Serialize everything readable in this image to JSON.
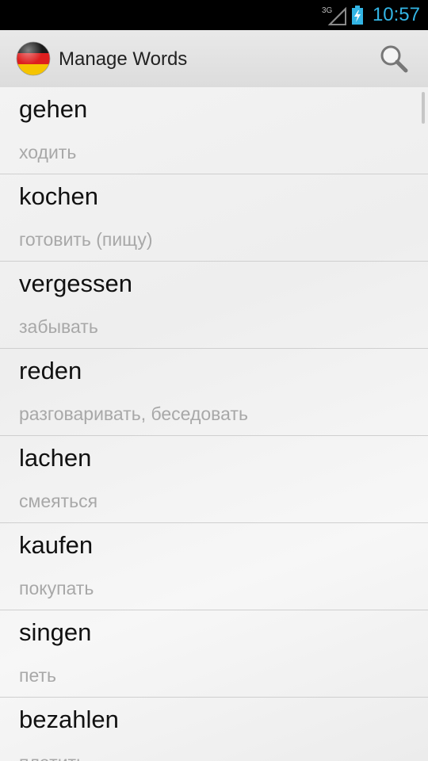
{
  "status_bar": {
    "network": "3G",
    "time": "10:57",
    "accent_color": "#33b5e5"
  },
  "action_bar": {
    "title": "Manage Words",
    "app_icon": "germany-flag-icon",
    "search_icon": "search-icon"
  },
  "words": [
    {
      "word": "gehen",
      "translation": "ходить"
    },
    {
      "word": "kochen",
      "translation": "готовить (пищу)"
    },
    {
      "word": "vergessen",
      "translation": "забывать"
    },
    {
      "word": "reden",
      "translation": "разговаривать, беседовать"
    },
    {
      "word": "lachen",
      "translation": "смеяться"
    },
    {
      "word": "kaufen",
      "translation": "покупать"
    },
    {
      "word": "singen",
      "translation": "петь"
    },
    {
      "word": "bezahlen",
      "translation": "платить"
    }
  ]
}
